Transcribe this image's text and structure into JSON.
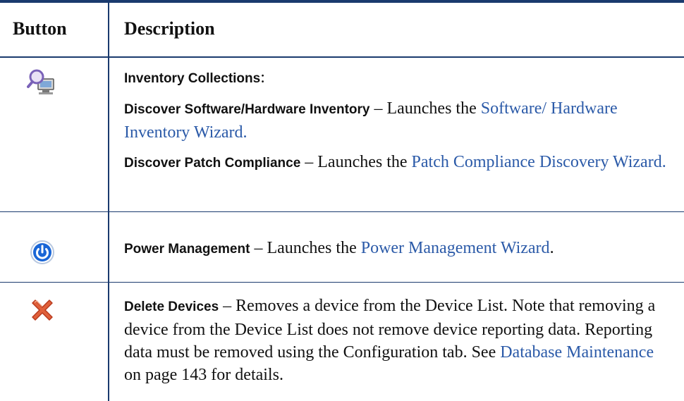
{
  "table": {
    "headers": {
      "button": "Button",
      "description": "Description"
    },
    "rows": [
      {
        "icon": "inventory-collections-icon",
        "title": "Inventory Collections",
        "title_suffix": ":",
        "items": [
          {
            "bold": "Discover Software/Hardware Inventory",
            "text": " – Launches the ",
            "link": "Software/ Hardware Inventory Wizard.",
            "after": ""
          },
          {
            "bold": "Discover Patch Compliance",
            "text": " – Launches the ",
            "link": "Patch Compliance Discovery Wizard.",
            "after": ""
          }
        ]
      },
      {
        "icon": "power-management-icon",
        "bold": "Power Management",
        "text": " – Launches the ",
        "link": "Power Management Wizard",
        "after": "."
      },
      {
        "icon": "delete-icon",
        "bold": "Delete Devices",
        "text": " – Removes a device from the Device List. Note that removing a device from the Device List does not remove device reporting data. Reporting data must be removed using the Configuration tab. See ",
        "link": "Database Maintenance",
        "after": " on page 143 for details."
      }
    ]
  },
  "colors": {
    "rule": "#1a3a6e",
    "link": "#2b5aa8",
    "power_icon": "#1a66d6",
    "delete_icon": "#e0603a"
  }
}
